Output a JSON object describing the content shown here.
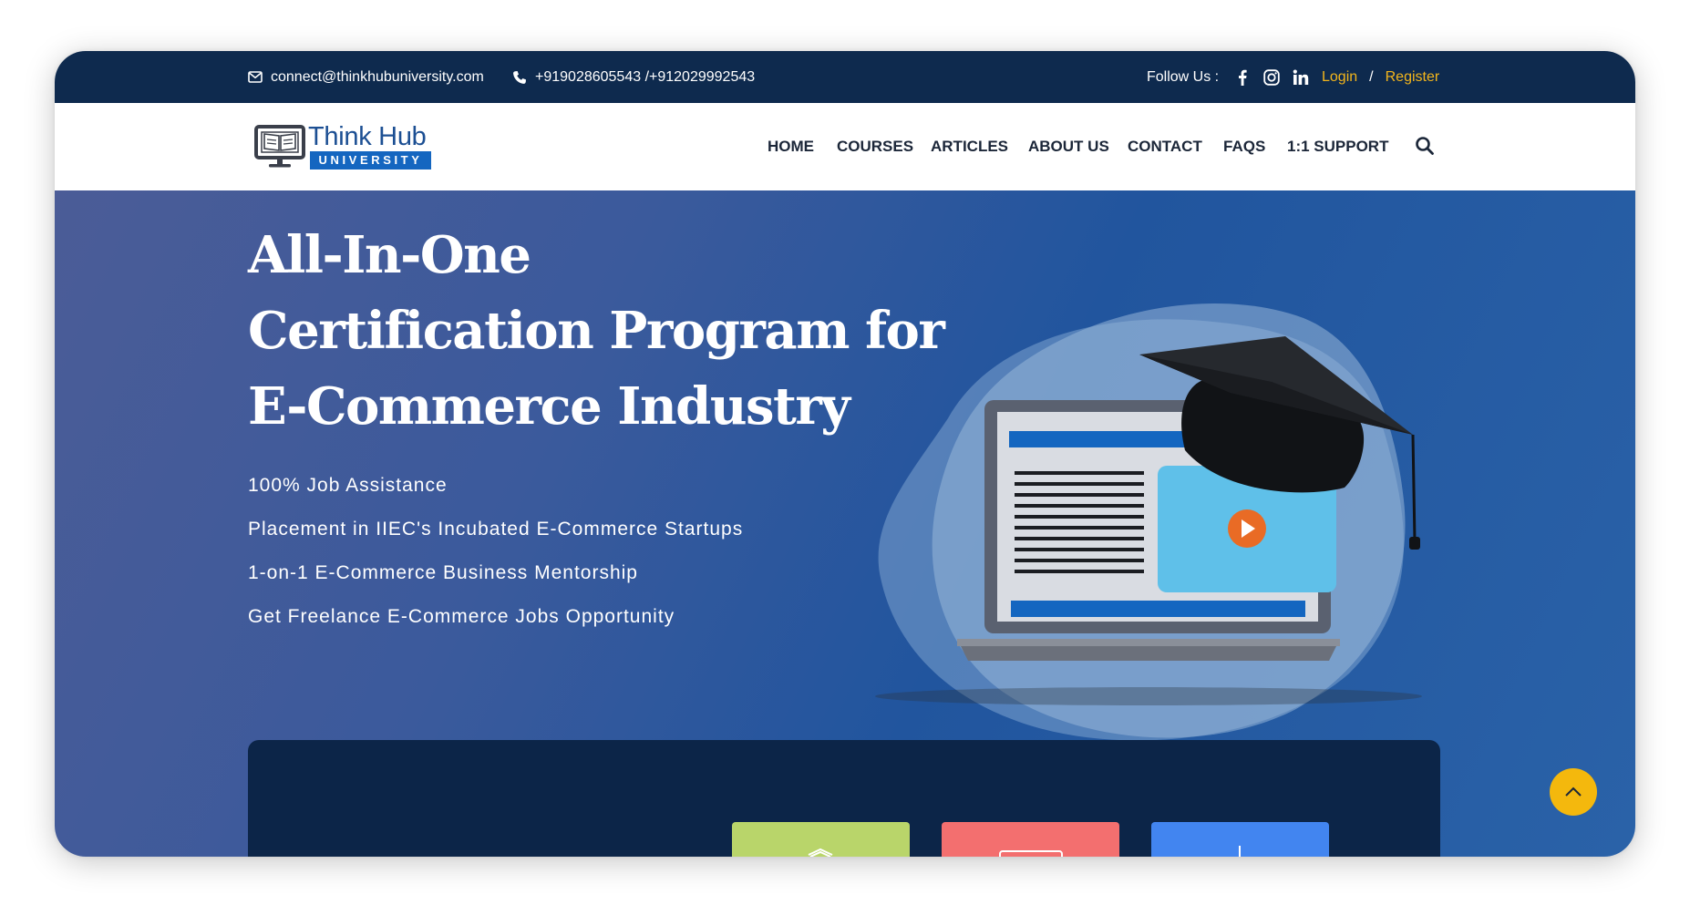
{
  "topbar": {
    "email": "connect@thinkhubuniversity.com",
    "phone": "+919028605543 /+912029992543",
    "follow_label": "Follow Us :",
    "socials": [
      "facebook-icon",
      "instagram-icon",
      "linkedin-icon"
    ],
    "login": "Login",
    "separator": "/",
    "register": "Register"
  },
  "logo": {
    "name": "Think Hub",
    "sub": "UNIVERSITY"
  },
  "nav": {
    "items": [
      "HOME",
      "COURSES",
      "ARTICLES",
      "ABOUT US",
      "CONTACT",
      "FAQS",
      "1:1 SUPPORT"
    ]
  },
  "hero": {
    "title_lines": [
      "All-In-One",
      "Certification Program for",
      "E-Commerce Industry"
    ],
    "features": [
      "100% Job Assistance",
      "Placement in IIEC's Incubated E-Commerce Startups",
      "1-on-1 E-Commerce Business Mentorship",
      "Get Freelance E-Commerce Jobs Opportunity"
    ]
  },
  "colors": {
    "topbar_bg": "#0e2a4e",
    "accent_gold": "#f3b51b",
    "brand_blue": "#1466c0",
    "panel_bg": "#0c2548",
    "tile_green": "#b9d56a",
    "tile_red": "#f36f6f",
    "tile_blue": "#4285f0"
  }
}
